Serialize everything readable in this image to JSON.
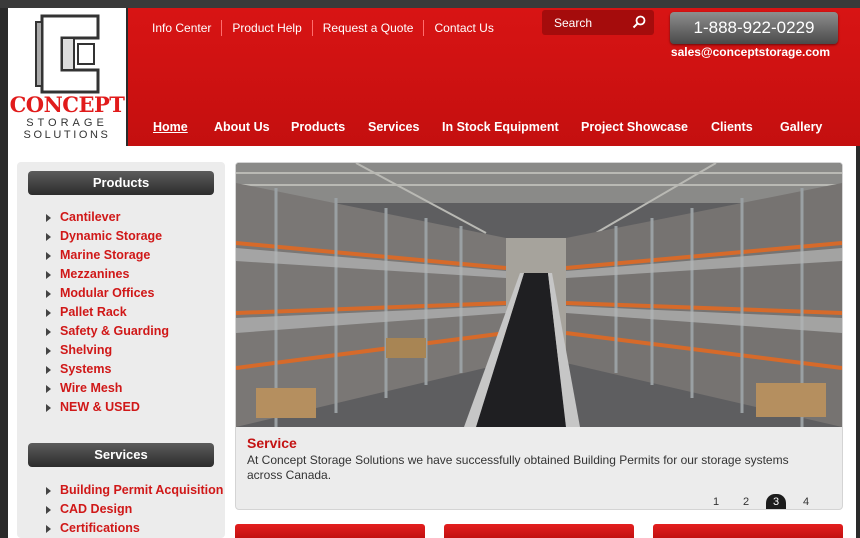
{
  "logo": {
    "brand": "CONCEPT",
    "line1": "STORAGE",
    "line2": "SOLUTIONS"
  },
  "topnav": [
    "Info Center",
    "Product Help",
    "Request a Quote",
    "Contact Us"
  ],
  "search": {
    "placeholder": "Search",
    "icon": "search-icon"
  },
  "phone": "1-888-922-0229",
  "email": "sales@conceptstorage.com",
  "mainnav": [
    {
      "label": "Home",
      "active": true
    },
    {
      "label": "About Us"
    },
    {
      "label": "Products"
    },
    {
      "label": "Services"
    },
    {
      "label": "In Stock Equipment"
    },
    {
      "label": "Project Showcase"
    },
    {
      "label": "Clients"
    },
    {
      "label": "Gallery"
    }
  ],
  "sidebar": {
    "products_title": "Products",
    "products": [
      "Cantilever",
      "Dynamic Storage",
      "Marine Storage",
      "Mezzanines",
      "Modular Offices",
      "Pallet Rack",
      "Safety & Guarding",
      "Shelving",
      "Systems",
      "Wire Mesh",
      "NEW & USED"
    ],
    "services_title": "Services",
    "services": [
      "Building Permit Acquisition",
      "CAD Design",
      "Certifications"
    ]
  },
  "slider": {
    "caption_title": "Service",
    "caption_text": "At Concept Storage Solutions we have successfully obtained Building Permits for our storage systems across Canada.",
    "pages": [
      "1",
      "2",
      "3",
      "4"
    ],
    "current_page": 3
  },
  "colors": {
    "brand_red": "#d81414",
    "link_red": "#d01818",
    "dark_header": "#2c2c2c"
  }
}
